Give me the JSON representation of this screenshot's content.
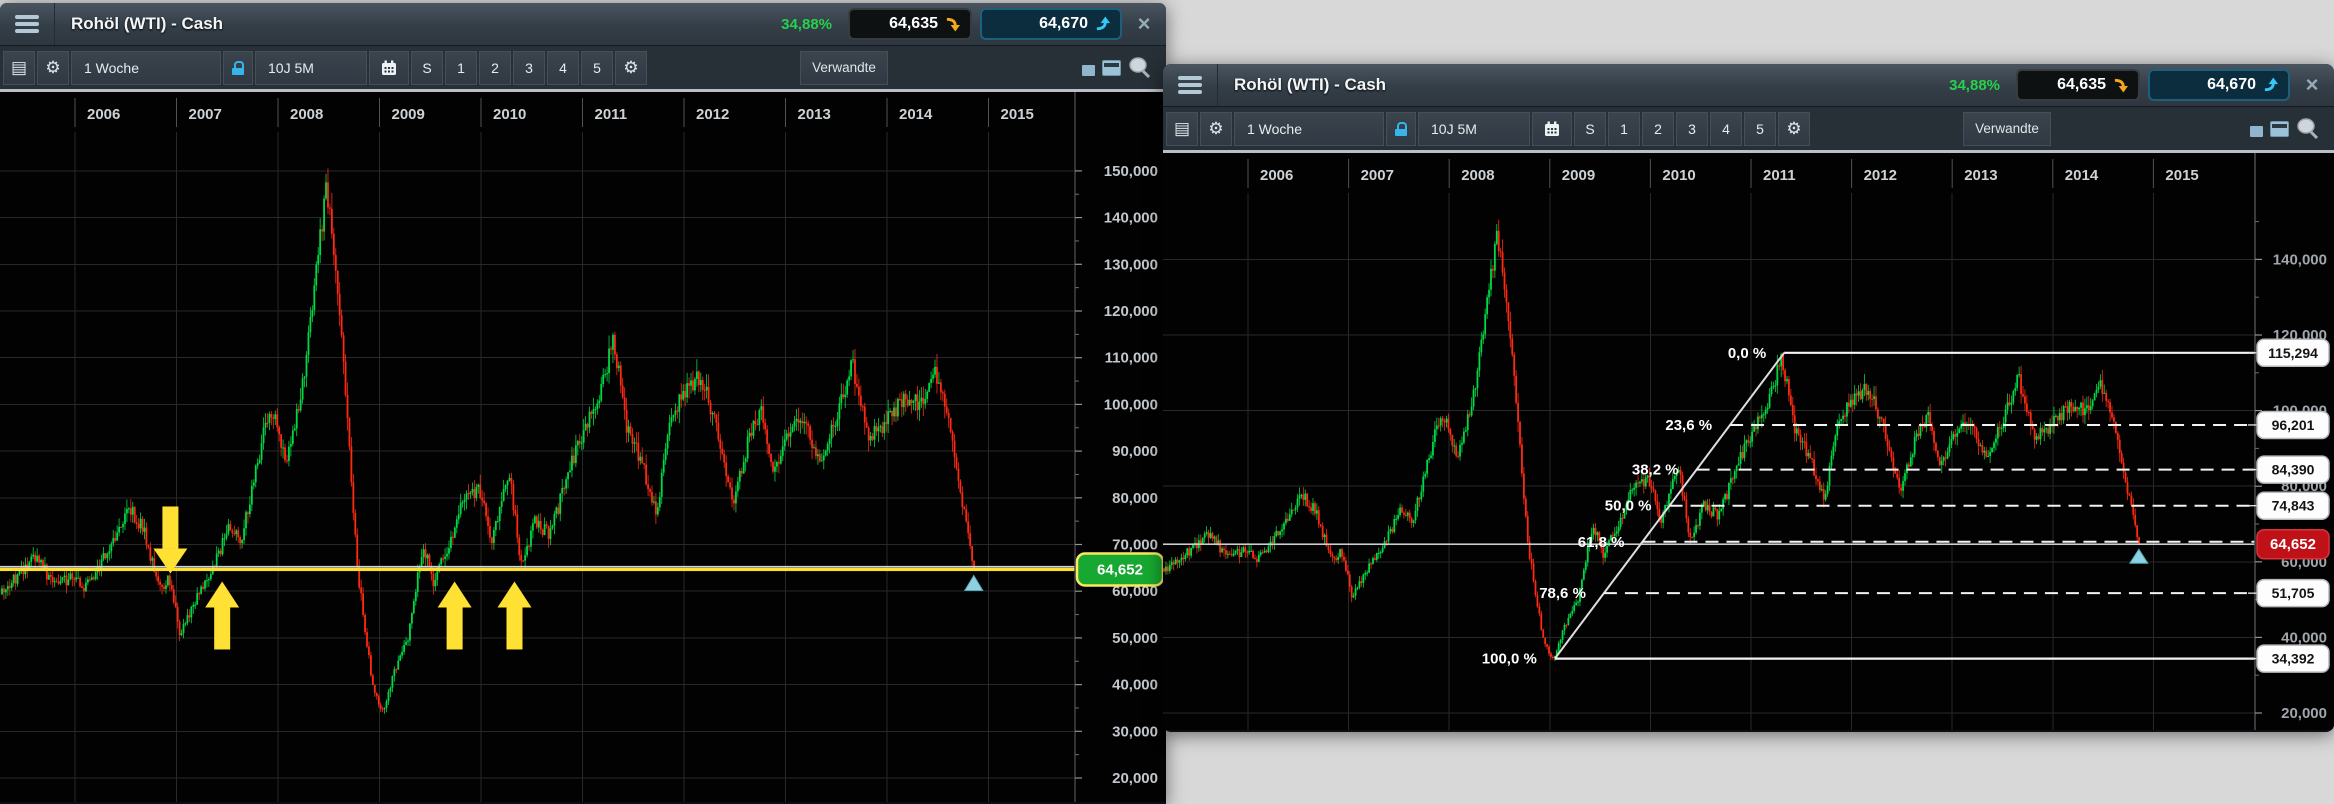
{
  "desktop": {
    "bg": "#d8d8d8"
  },
  "icons": {
    "menu": "hamburger-icon",
    "indicator_list": "list-icon",
    "settings": "gear-icon",
    "lock": "lock-icon",
    "calendar": "calendar-icon",
    "sell_arrow": "curved-down-arrow-icon",
    "buy_arrow": "curved-up-arrow-icon",
    "close": "close-x-icon",
    "minimize": "minimize-icon",
    "window": "window-icon",
    "search": "magnifier-icon",
    "last_candle_marker": "triangle-marker-icon"
  },
  "window_left": {
    "title": "Rohöl (WTI) - Cash",
    "change_pct": "34,88%",
    "sell_price": "64,635",
    "buy_price": "64,670",
    "close_glyph": "×",
    "toolbar": {
      "list_glyph": "▤",
      "gear_glyph": "⚙",
      "period": "1 Woche",
      "range": "10J 5M",
      "buttons": [
        "S",
        "1",
        "2",
        "3",
        "4",
        "5"
      ],
      "related": "Verwandte"
    },
    "years": [
      "2006",
      "2007",
      "2008",
      "2009",
      "2010",
      "2011",
      "2012",
      "2013",
      "2014",
      "2015"
    ],
    "y_axis": [
      "150,000",
      "140,000",
      "130,000",
      "120,000",
      "110,000",
      "100,000",
      "90,000",
      "80,000",
      "70,000",
      "60,000",
      "50,000",
      "40,000",
      "30,000",
      "20,000"
    ],
    "price_tag": "64,652"
  },
  "window_right": {
    "title": "Rohöl (WTI) - Cash",
    "change_pct": "34,88%",
    "sell_price": "64,635",
    "buy_price": "64,670",
    "close_glyph": "×",
    "toolbar": {
      "list_glyph": "▤",
      "gear_glyph": "⚙",
      "period": "1 Woche",
      "range": "10J 5M",
      "buttons": [
        "S",
        "1",
        "2",
        "3",
        "4",
        "5"
      ],
      "related": "Verwandte"
    },
    "years": [
      "2006",
      "2007",
      "2008",
      "2009",
      "2010",
      "2011",
      "2012",
      "2013",
      "2014",
      "2015"
    ],
    "y_axis": [
      "140,000",
      "120,000",
      "100,000",
      "80,000",
      "60,000",
      "40,000",
      "20,000"
    ],
    "current_tag": "64,652",
    "fib_labels": [
      "0,0 %",
      "23,6 %",
      "38,2 %",
      "50,0 %",
      "61,8 %",
      "78,6 %",
      "100,0 %"
    ],
    "fib_tags": [
      "115,294",
      "96,201",
      "84,390",
      "74,843",
      "51,705",
      "34,392"
    ]
  },
  "chart_data": {
    "type": "candlestick",
    "instrument": "Rohöl (WTI) - Cash",
    "timeframe_per_candle": "1 Woche",
    "visible_range": "10J 5M",
    "x_tick_years": [
      2006,
      2007,
      2008,
      2009,
      2010,
      2011,
      2012,
      2013,
      2014,
      2015
    ],
    "left_panel_y_axis": {
      "min": 20.0,
      "max": 150.0,
      "tick_step": 10.0,
      "format": "German decimal comma, e.g. 64,652"
    },
    "right_panel_y_axis": {
      "min": 20.0,
      "max": 150.0,
      "tick_step": 20.0
    },
    "current_price": 64.652,
    "sell_quote": 64.635,
    "buy_quote": 64.67,
    "change_pct_display": "34,88%",
    "price_path": [
      [
        2005.12,
        57
      ],
      [
        2005.3,
        60
      ],
      [
        2005.5,
        64
      ],
      [
        2005.65,
        68
      ],
      [
        2005.8,
        61
      ],
      [
        2006.0,
        63
      ],
      [
        2006.12,
        61
      ],
      [
        2006.3,
        67
      ],
      [
        2006.55,
        78
      ],
      [
        2006.7,
        73
      ],
      [
        2006.85,
        60
      ],
      [
        2006.95,
        63
      ],
      [
        2007.05,
        51
      ],
      [
        2007.2,
        58
      ],
      [
        2007.35,
        64
      ],
      [
        2007.55,
        74
      ],
      [
        2007.65,
        70
      ],
      [
        2007.9,
        96
      ],
      [
        2008.0,
        97
      ],
      [
        2008.1,
        87
      ],
      [
        2008.25,
        102
      ],
      [
        2008.5,
        147
      ],
      [
        2008.65,
        115
      ],
      [
        2008.8,
        65
      ],
      [
        2008.95,
        40
      ],
      [
        2009.05,
        34
      ],
      [
        2009.15,
        42
      ],
      [
        2009.3,
        50
      ],
      [
        2009.45,
        70
      ],
      [
        2009.55,
        62
      ],
      [
        2009.75,
        72
      ],
      [
        2009.85,
        80
      ],
      [
        2010.0,
        82
      ],
      [
        2010.12,
        71
      ],
      [
        2010.3,
        85
      ],
      [
        2010.42,
        65
      ],
      [
        2010.55,
        75
      ],
      [
        2010.7,
        72
      ],
      [
        2010.9,
        87
      ],
      [
        2011.0,
        92
      ],
      [
        2011.15,
        100
      ],
      [
        2011.33,
        114
      ],
      [
        2011.45,
        95
      ],
      [
        2011.6,
        88
      ],
      [
        2011.75,
        76
      ],
      [
        2011.85,
        94
      ],
      [
        2012.0,
        102
      ],
      [
        2012.18,
        106
      ],
      [
        2012.35,
        95
      ],
      [
        2012.5,
        78
      ],
      [
        2012.65,
        92
      ],
      [
        2012.78,
        99
      ],
      [
        2012.9,
        85
      ],
      [
        2013.05,
        94
      ],
      [
        2013.2,
        97
      ],
      [
        2013.35,
        87
      ],
      [
        2013.55,
        99
      ],
      [
        2013.67,
        109
      ],
      [
        2013.85,
        93
      ],
      [
        2014.0,
        96
      ],
      [
        2014.18,
        101
      ],
      [
        2014.35,
        100
      ],
      [
        2014.5,
        107
      ],
      [
        2014.62,
        97
      ],
      [
        2014.75,
        81
      ],
      [
        2014.875,
        64.652
      ]
    ],
    "horizontal_line_left_panel": 64.652,
    "arrow_annotations_left_panel": [
      {
        "direction": "down",
        "year": 2006.94,
        "price": 64.652
      },
      {
        "direction": "up",
        "year": 2007.45,
        "price": 64.652
      },
      {
        "direction": "up",
        "year": 2009.74,
        "price": 64.652
      },
      {
        "direction": "up",
        "year": 2010.33,
        "price": 64.652
      }
    ],
    "fibonacci_right_panel": {
      "anchor_low": {
        "year": 2009.05,
        "price": 34.392
      },
      "anchor_high": {
        "year": 2011.33,
        "price": 115.294
      },
      "levels": [
        {
          "pct": 0.0,
          "price": 115.294
        },
        {
          "pct": 23.6,
          "price": 96.201
        },
        {
          "pct": 38.2,
          "price": 84.39
        },
        {
          "pct": 50.0,
          "price": 74.843
        },
        {
          "pct": 61.8,
          "price": 65.296
        },
        {
          "pct": 78.6,
          "price": 51.705
        },
        {
          "pct": 100.0,
          "price": 34.392
        }
      ]
    }
  }
}
